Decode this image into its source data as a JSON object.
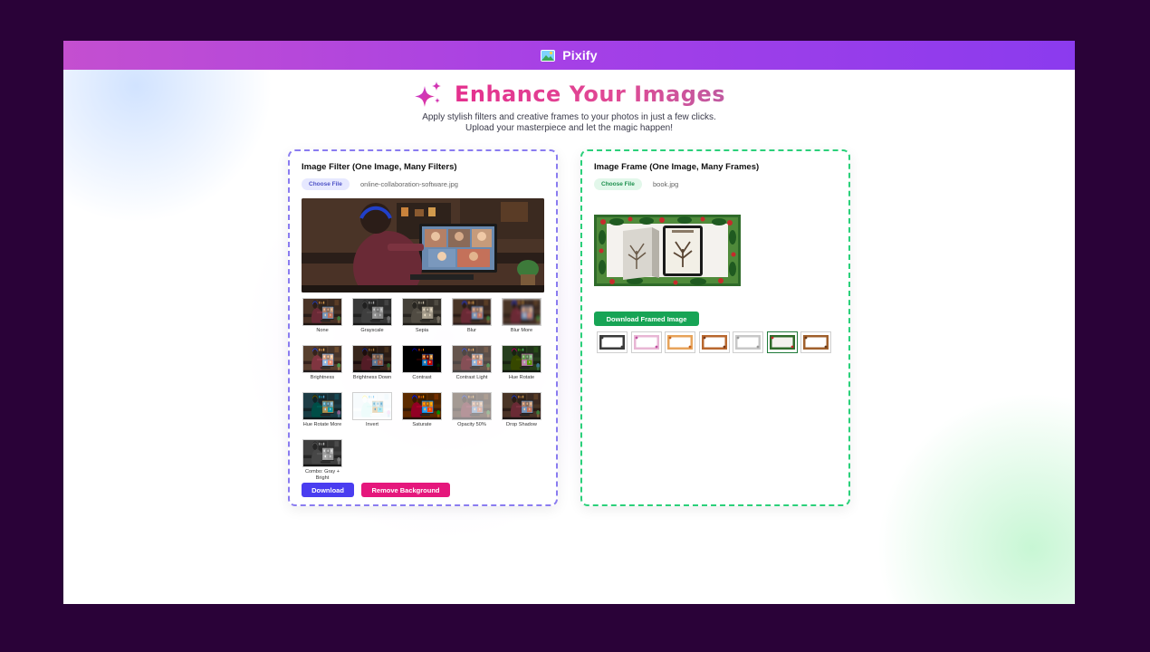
{
  "app": {
    "name": "Pixify",
    "logo_icon": "image-icon"
  },
  "hero": {
    "title": "Enhance Your Images",
    "icon": "sparkles-icon",
    "subtitle_line1": "Apply stylish filters and creative frames to your photos in just a few clicks.",
    "subtitle_line2": "Upload your masterpiece and let the magic happen!"
  },
  "filter_panel": {
    "title": "Image Filter (One Image, Many Filters)",
    "choose_label": "Choose File",
    "file_name": "online-collaboration-software.jpg",
    "filters": [
      {
        "label": "None"
      },
      {
        "label": "Grayscale"
      },
      {
        "label": "Sepia"
      },
      {
        "label": "Blur"
      },
      {
        "label": "Blur More"
      },
      {
        "label": "Brightness"
      },
      {
        "label": "Brightness Down"
      },
      {
        "label": "Contrast"
      },
      {
        "label": "Contrast Light"
      },
      {
        "label": "Hue Rotate"
      },
      {
        "label": "Hue Rotate More"
      },
      {
        "label": "Invert"
      },
      {
        "label": "Saturate"
      },
      {
        "label": "Opacity 50%"
      },
      {
        "label": "Drop Shadow"
      },
      {
        "label": "Combo: Gray + Bright"
      }
    ],
    "download_label": "Download",
    "remove_bg_label": "Remove Background"
  },
  "frame_panel": {
    "title": "Image Frame (One Image, Many Frames)",
    "choose_label": "Choose File",
    "file_name": "book.jpg",
    "download_label": "Download Framed Image",
    "frames": [
      {
        "style": "plain-dark"
      },
      {
        "style": "pink-floral"
      },
      {
        "style": "orange-floral"
      },
      {
        "style": "autumn-leaves"
      },
      {
        "style": "silver-ornate"
      },
      {
        "style": "holly-green",
        "selected": true
      },
      {
        "style": "rustic-brown"
      }
    ]
  },
  "colors": {
    "header_start": "#c44fd0",
    "header_end": "#8b3bee",
    "title_pink": "#e4308e",
    "filter_border": "#8a7cf0",
    "frame_border": "#2bd07a",
    "download_btn": "#4a3df0",
    "remove_bg_btn": "#e5177c",
    "download_framed_btn": "#17a455"
  }
}
